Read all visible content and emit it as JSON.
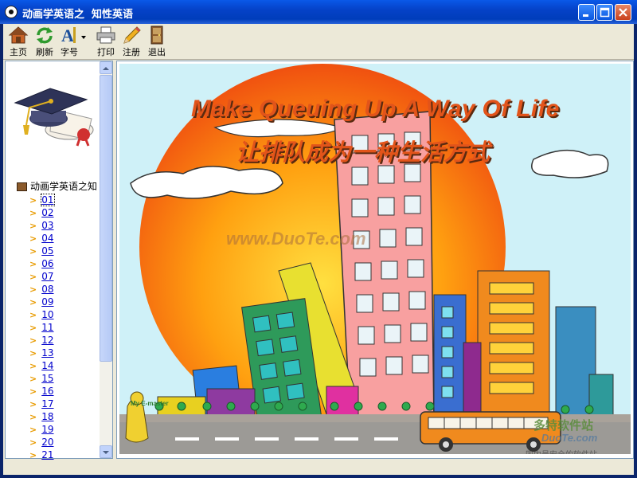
{
  "window": {
    "title": "动画学英语之  知性英语"
  },
  "toolbar": {
    "items": [
      {
        "label": "主页",
        "icon": "home-icon"
      },
      {
        "label": "刷新",
        "icon": "refresh-icon"
      },
      {
        "label": "字号",
        "icon": "font-size-icon"
      },
      {
        "label": "打印",
        "icon": "print-icon"
      },
      {
        "label": "注册",
        "icon": "register-pencil-icon"
      },
      {
        "label": "退出",
        "icon": "exit-door-icon"
      }
    ]
  },
  "sidebar": {
    "logo_icon": "graduation-cap-icon",
    "root_label": "动画学英语之知",
    "items": [
      "01",
      "02",
      "03",
      "04",
      "05",
      "06",
      "07",
      "08",
      "09",
      "10",
      "11",
      "12",
      "13",
      "14",
      "15",
      "16",
      "17",
      "18",
      "19",
      "20",
      "21"
    ],
    "selected": "01"
  },
  "content": {
    "heading_en": "Make Queuing Up A Way Of Life",
    "heading_cn": "让排队成为一种生活方式",
    "watermark": "www.DuoTe.com",
    "corner_brand_cn": "多特软件站",
    "corner_brand_en": "DuoTe.com",
    "corner_slogan": "国内最安全的软件站",
    "character_logo": "My E-master"
  },
  "colors": {
    "title_bar": "#0542C8",
    "sky": "#CFF1F8",
    "heading": "#E2541A",
    "link": "#0000CC"
  }
}
